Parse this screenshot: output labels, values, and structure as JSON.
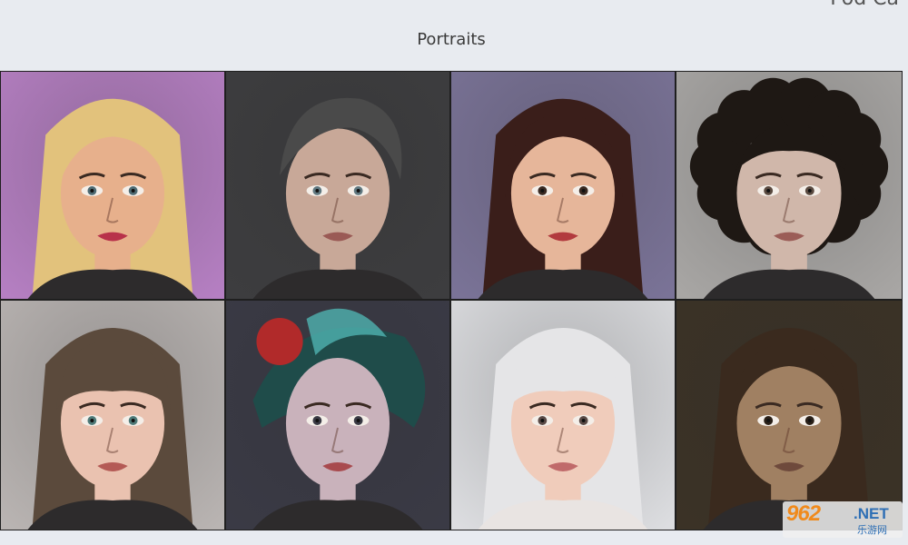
{
  "header": {
    "corner_text": "Pod Ca",
    "title": "Portraits"
  },
  "portraits": [
    {
      "name": "portrait-blonde-woman",
      "bg": "#b57fc2",
      "skin": "#e7b08c",
      "hair": "#e2c27c",
      "lips": "#b8314a",
      "eyes": "#4e6b73",
      "style": "long"
    },
    {
      "name": "portrait-short-hair",
      "bg": "#3d3d3f",
      "skin": "#c8a898",
      "hair": "#4a4a4a",
      "lips": "#9a5a55",
      "eyes": "#607880",
      "style": "short"
    },
    {
      "name": "portrait-brunette-woman",
      "bg": "#7a7397",
      "skin": "#e6b69a",
      "hair": "#3a1e1a",
      "lips": "#b23a3e",
      "eyes": "#3a2a22",
      "style": "long"
    },
    {
      "name": "portrait-curly-man",
      "bg": "#a8a6a4",
      "skin": "#d0b7aa",
      "hair": "#1e1814",
      "lips": "#9b5d57",
      "eyes": "#5a4a40",
      "style": "curly"
    },
    {
      "name": "portrait-wavy-bangs",
      "bg": "#b9b4b2",
      "skin": "#eac2b0",
      "hair": "#5b4a3c",
      "lips": "#b45a55",
      "eyes": "#4e7a78",
      "style": "bangs"
    },
    {
      "name": "portrait-feather-hat",
      "bg": "#3a3a45",
      "skin": "#c9b2bb",
      "hair": "#2a3236",
      "lips": "#a84a4e",
      "eyes": "#3a3a44",
      "style": "hat"
    },
    {
      "name": "portrait-white-hair",
      "bg": "#dcdde0",
      "skin": "#f0ccbb",
      "hair": "#e5e5e7",
      "lips": "#c06a6a",
      "eyes": "#5a4a46",
      "style": "white"
    },
    {
      "name": "portrait-dark-warrior",
      "bg": "#3b3226",
      "skin": "#a08062",
      "hair": "#3a2a1e",
      "lips": "#6e4a3c",
      "eyes": "#2a2018",
      "style": "long"
    }
  ],
  "watermark": {
    "brand": "962",
    "net": ".NET",
    "sub": "乐游网"
  }
}
